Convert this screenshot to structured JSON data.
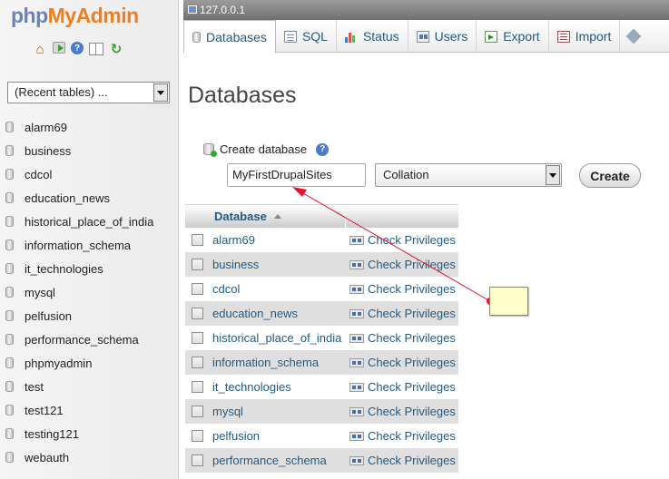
{
  "logo": {
    "part1": "php",
    "part2": "MyAdmin"
  },
  "nav": {
    "recent_tables": "(Recent tables) ...",
    "databases": [
      "alarm69",
      "business",
      "cdcol",
      "education_news",
      "historical_place_of_india",
      "information_schema",
      "it_technologies",
      "mysql",
      "pelfusion",
      "performance_schema",
      "phpmyadmin",
      "test",
      "test121",
      "testing121",
      "webauth"
    ]
  },
  "server": {
    "label": "127.0.0.1"
  },
  "tabs": [
    {
      "label": "Databases",
      "icon": "database-icon",
      "active": true
    },
    {
      "label": "SQL",
      "icon": "sql-icon"
    },
    {
      "label": "Status",
      "icon": "status-icon"
    },
    {
      "label": "Users",
      "icon": "users-icon"
    },
    {
      "label": "Export",
      "icon": "export-icon"
    },
    {
      "label": "Import",
      "icon": "import-icon"
    }
  ],
  "main": {
    "title": "Databases",
    "create": {
      "label": "Create database",
      "name_value": "MyFirstDrupalSites",
      "collation_value": "Collation",
      "button_label": "Create"
    },
    "table": {
      "header": "Database",
      "privileges_label": "Check Privileges",
      "rows": [
        "alarm69",
        "business",
        "cdcol",
        "education_news",
        "historical_place_of_india",
        "information_schema",
        "it_technologies",
        "mysql",
        "pelfusion",
        "performance_schema"
      ]
    }
  },
  "colors": {
    "link": "#235a81",
    "logo_blue": "#6a84b8",
    "logo_orange": "#f07e1f",
    "annotation": "#e8112d",
    "note": "#ffffcc"
  }
}
